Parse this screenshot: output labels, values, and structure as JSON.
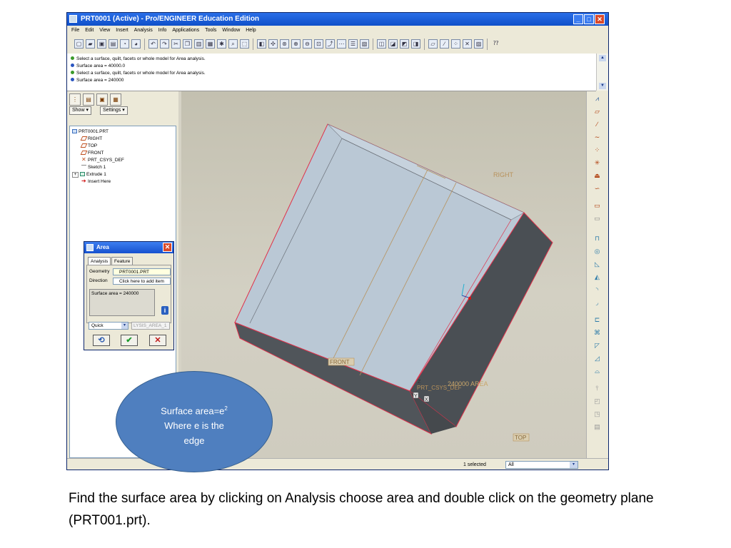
{
  "window": {
    "title": "PRT0001 (Active) - Pro/ENGINEER Education Edition",
    "min_glyph": "_",
    "max_glyph": "□",
    "close_glyph": "✕"
  },
  "menu": [
    "File",
    "Edit",
    "View",
    "Insert",
    "Analysis",
    "Info",
    "Applications",
    "Tools",
    "Window",
    "Help"
  ],
  "messages": [
    "Select a surface, quilt, facets or whole model for Area analysis.",
    "Surface area = 40000.0",
    "Select a surface, quilt, facets or whole model for Area analysis.",
    "Surface area = 240000"
  ],
  "nav": {
    "show_label": "Show ▾",
    "settings_label": "Settings ▾",
    "tree": [
      "PRT0001.PRT",
      "RIGHT",
      "TOP",
      "FRONT",
      "PRT_CSYS_DEF",
      "Sketch 1",
      "Extrude 1",
      "Insert Here"
    ],
    "expand_glyph": "+"
  },
  "dialog": {
    "title": "Area",
    "tabs": [
      "Analysis",
      "Feature"
    ],
    "geometry_label": "Geometry",
    "geometry_value": "PRT0001.PRT",
    "direction_label": "Direction",
    "direction_value": "Click here to add item",
    "result": "Surface area = 240000",
    "mode": "Quick",
    "name_value": "LYSIS_AREA_1",
    "info_glyph": "i",
    "dropdown_glyph": "▾",
    "repeat_glyph": "⟲",
    "ok_glyph": "✔",
    "cancel_glyph": "✕"
  },
  "model_labels": {
    "right": "RIGHT",
    "front": "FRONT",
    "top": "TOP",
    "csys": "PRT_CSYS_DEF",
    "area": "240000 AREA",
    "z": "Z",
    "y": "Y",
    "x": "X"
  },
  "status": {
    "selected": "1 selected",
    "filter": "All",
    "dropdown_glyph": "▾"
  },
  "callout": {
    "line1_prefix": "Surface area=e",
    "line1_sup": "2",
    "line2": "Where e is the",
    "line3": "edge"
  },
  "caption": "Find the surface area by clicking on Analysis choose area and double click on the geometry plane (PRT001.prt).",
  "icons": [
    "app-icon",
    "new-icon",
    "open-icon",
    "save-icon",
    "print-icon",
    "undo-icon",
    "redo-icon",
    "cut-icon",
    "copy-icon",
    "paste-icon",
    "zoom-in-icon",
    "zoom-out-icon",
    "repaint-icon",
    "spin-icon",
    "view-icon",
    "shading-icon",
    "wireframe-icon",
    "datum-plane-icon",
    "datum-axis-icon",
    "datum-point-icon",
    "csys-icon",
    "help-icon"
  ],
  "colors": {
    "title_bar": "#0f4fc9",
    "edge_highlight": "#e0304a",
    "callout_fill": "#4f7fbf",
    "face_light": "#b8c6d3",
    "face_dark": "#4e5358"
  }
}
